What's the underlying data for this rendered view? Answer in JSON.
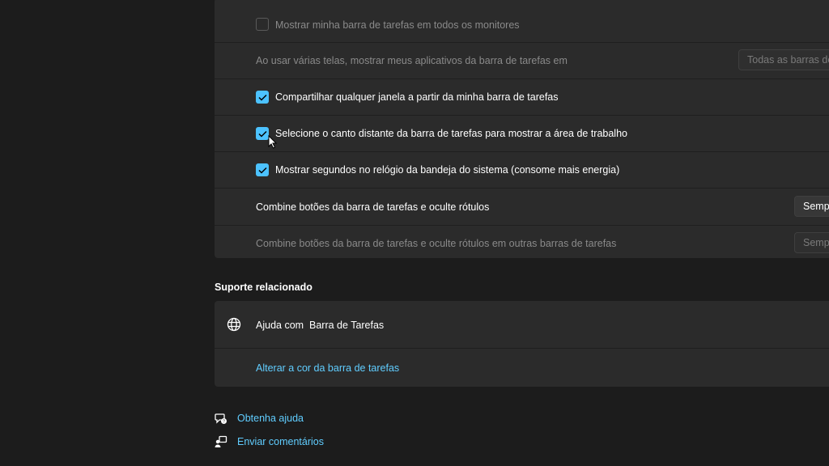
{
  "taskbar_settings": {
    "rows": [
      {
        "label": "Mostrar minha barra de tarefas em todos os monitores",
        "checkbox": "unchecked"
      },
      {
        "label": "Ao usar várias telas, mostrar meus aplicativos da barra de tarefas em",
        "dropdown": "Todas as barras de"
      },
      {
        "label": "Compartilhar qualquer janela a partir da minha barra de tarefas",
        "checkbox": "checked"
      },
      {
        "label": "Selecione o canto distante da barra de tarefas para mostrar a área de trabalho",
        "checkbox": "checked"
      },
      {
        "label": "Mostrar segundos no relógio da bandeja do sistema (consome mais energia)",
        "checkbox": "checked"
      },
      {
        "label": "Combine botões da barra de tarefas e oculte rótulos",
        "dropdown": "Sempr"
      },
      {
        "label": "Combine botões da barra de tarefas e oculte rótulos em outras barras de tarefas",
        "dropdown": "Sempr"
      }
    ]
  },
  "related_support": {
    "title": "Suporte relacionado",
    "help_item": {
      "label": "Ajuda com  Barra de Tarefas",
      "icon": "globe-icon"
    },
    "link": "Alterar a cor da barra de tarefas"
  },
  "footer": {
    "get_help": "Obtenha ajuda",
    "feedback": "Enviar comentários"
  },
  "colors": {
    "accent": "#4cc2ff",
    "link": "#60cdff",
    "card": "#2b2b2b",
    "background": "#1c1c1c"
  }
}
